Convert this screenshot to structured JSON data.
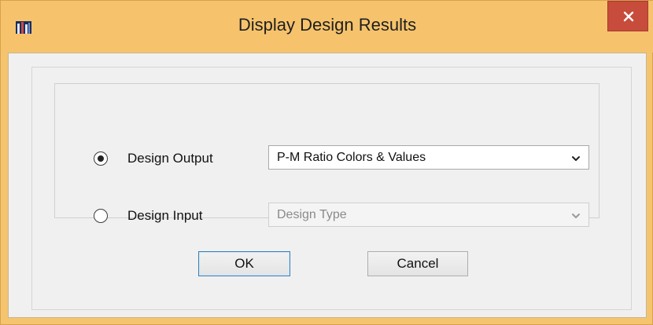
{
  "window": {
    "title": "Display Design Results"
  },
  "form": {
    "options": [
      {
        "label": "Design Output",
        "selected": true,
        "dropdown": "P-M Ratio Colors & Values",
        "enabled": true
      },
      {
        "label": "Design Input",
        "selected": false,
        "dropdown": "Design Type",
        "enabled": false
      }
    ]
  },
  "buttons": {
    "ok": "OK",
    "cancel": "Cancel"
  },
  "colors": {
    "titlebar": "#f6c36c",
    "close": "#c74c3c",
    "client": "#f0f0f0"
  },
  "icons": {
    "app": "app-icon",
    "close": "close-icon",
    "chevron": "chevron-down-icon"
  }
}
